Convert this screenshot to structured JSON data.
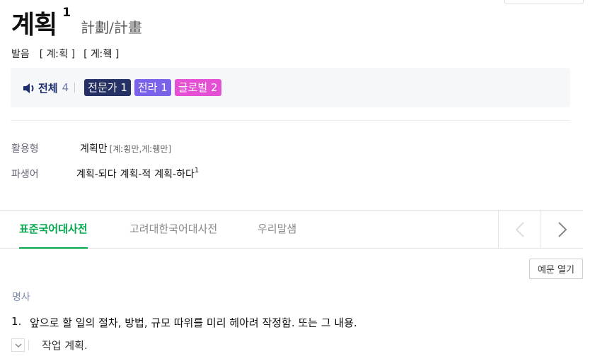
{
  "headword": {
    "text": "계획",
    "superscript": "1",
    "hanja": "計劃/計畫"
  },
  "pronunciation": {
    "label": "발음",
    "forms": [
      "[ 계ː획 ]",
      "[ 게ː훽 ]"
    ]
  },
  "listen": {
    "all_label": "전체",
    "all_count": "4",
    "badges": [
      {
        "label": "전문가 1",
        "color": "#253164"
      },
      {
        "label": "전라 1",
        "color": "#7a63e8"
      },
      {
        "label": "글로벌 2",
        "color": "#e54fd3"
      }
    ]
  },
  "conjugation": {
    "label": "활용형",
    "main": "계획만",
    "sub": "[계ː횡만,게ː휑만]"
  },
  "derivatives": {
    "label": "파생어",
    "items": [
      "계획-되다",
      "계획-적",
      "계획-하다"
    ],
    "last_superscript": "1"
  },
  "tabs": [
    "표준국어대사전",
    "고려대한국어대사전",
    "우리말샘"
  ],
  "active_tab": 0,
  "example_button": "예문 열기",
  "part_of_speech": "명사",
  "definition": {
    "number": "1.",
    "text": "앞으로 할 일의 절차, 방법, 규모 따위를 미리 헤아려 작정함. 또는 그 내용."
  },
  "example": {
    "text": "작업 계획."
  },
  "colors": {
    "accent": "#03a84d",
    "navy": "#1c2b6b"
  }
}
